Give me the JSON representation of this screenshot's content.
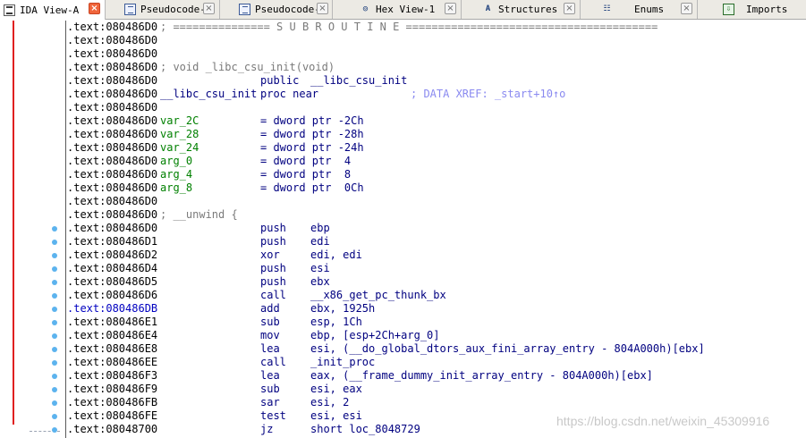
{
  "tabs": [
    {
      "label": "IDA View-A",
      "icon": "ida-view-icon",
      "active": true
    },
    {
      "label": "Pseudocode-B",
      "icon": "pseudocode-icon",
      "active": false
    },
    {
      "label": "Pseudocode-A",
      "icon": "pseudocode-icon",
      "active": false
    },
    {
      "label": "Hex View-1",
      "icon": "hex-view-icon",
      "active": false
    },
    {
      "label": "Structures",
      "icon": "structures-icon",
      "active": false
    },
    {
      "label": "Enums",
      "icon": "enums-icon",
      "active": false
    },
    {
      "label": "Imports",
      "icon": "imports-icon",
      "active": false
    }
  ],
  "tab_close_glyph": "×",
  "listing": [
    {
      "addr": ".text:080486D0",
      "comment": "; =============== S U B R O U T I N E ======================================="
    },
    {
      "addr": ".text:080486D0"
    },
    {
      "addr": ".text:080486D0"
    },
    {
      "addr": ".text:080486D0",
      "comment": "; void _libc_csu_init(void)"
    },
    {
      "addr": ".text:080486D0",
      "mnemonic": "public",
      "operand": "__libc_csu_init"
    },
    {
      "addr": ".text:080486D0",
      "name": "__libc_csu_init",
      "mnemonic": "proc near",
      "xref": "; DATA XREF: _start+10↑o"
    },
    {
      "addr": ".text:080486D0"
    },
    {
      "addr": ".text:080486D0",
      "var": "var_2C",
      "mnemonic": "= dword ptr -2Ch"
    },
    {
      "addr": ".text:080486D0",
      "var": "var_28",
      "mnemonic": "= dword ptr -28h"
    },
    {
      "addr": ".text:080486D0",
      "var": "var_24",
      "mnemonic": "= dword ptr -24h"
    },
    {
      "addr": ".text:080486D0",
      "var": "arg_0",
      "mnemonic": "= dword ptr  4"
    },
    {
      "addr": ".text:080486D0",
      "var": "arg_4",
      "mnemonic": "= dword ptr  8"
    },
    {
      "addr": ".text:080486D0",
      "var": "arg_8",
      "mnemonic": "= dword ptr  0Ch"
    },
    {
      "addr": ".text:080486D0"
    },
    {
      "addr": ".text:080486D0",
      "comment": "; __unwind {"
    },
    {
      "addr": ".text:080486D0",
      "mnemonic": "push",
      "operand": "ebp"
    },
    {
      "addr": ".text:080486D1",
      "mnemonic": "push",
      "operand": "edi"
    },
    {
      "addr": ".text:080486D2",
      "mnemonic": "xor",
      "operand": "edi, edi"
    },
    {
      "addr": ".text:080486D4",
      "mnemonic": "push",
      "operand": "esi"
    },
    {
      "addr": ".text:080486D5",
      "mnemonic": "push",
      "operand": "ebx"
    },
    {
      "addr": ".text:080486D6",
      "mnemonic": "call",
      "operand": "__x86_get_pc_thunk_bx"
    },
    {
      "addr": ".text:080486DB",
      "mnemonic": "add",
      "operand": "ebx, 1925h",
      "highlight": true
    },
    {
      "addr": ".text:080486E1",
      "mnemonic": "sub",
      "operand": "esp, 1Ch"
    },
    {
      "addr": ".text:080486E4",
      "mnemonic": "mov",
      "operand": "ebp, [esp+2Ch+arg_0]"
    },
    {
      "addr": ".text:080486E8",
      "mnemonic": "lea",
      "operand": "esi, (__do_global_dtors_aux_fini_array_entry - 804A000h)[ebx]"
    },
    {
      "addr": ".text:080486EE",
      "mnemonic": "call",
      "operand": "_init_proc"
    },
    {
      "addr": ".text:080486F3",
      "mnemonic": "lea",
      "operand": "eax, (__frame_dummy_init_array_entry - 804A000h)[ebx]"
    },
    {
      "addr": ".text:080486F9",
      "mnemonic": "sub",
      "operand": "esi, eax"
    },
    {
      "addr": ".text:080486FB",
      "mnemonic": "sar",
      "operand": "esi, 2"
    },
    {
      "addr": ".text:080486FE",
      "mnemonic": "test",
      "operand": "esi, esi"
    },
    {
      "addr": ".text:08048700",
      "mnemonic": "jz",
      "operand": "short loc_8048729"
    }
  ],
  "watermark": "https://blog.csdn.net/weixin_45309916",
  "colors": {
    "address": "#000000",
    "address_highlight": "#0000c0",
    "comment": "#7a7a7a",
    "code": "#000080",
    "variable": "#008000",
    "xref": "#8a8af0",
    "flow_line": "#e02020",
    "breakpoint_dot": "#5cb3ee",
    "active_tab_close": "#f0653b"
  }
}
